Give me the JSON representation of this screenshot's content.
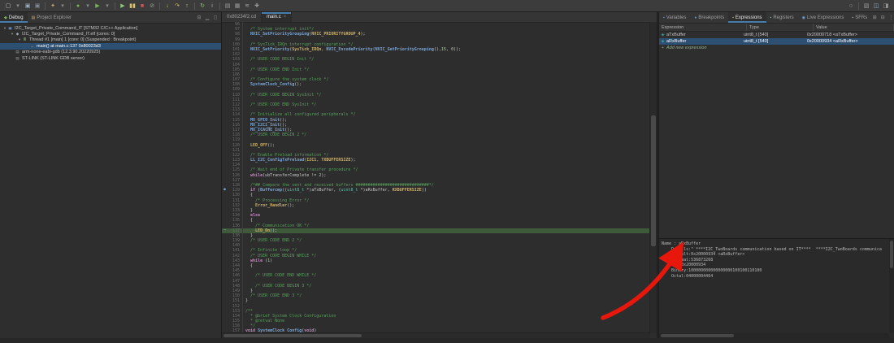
{
  "colors": {
    "annotation_red": "#e8170c",
    "selection_blue": "#2d4f72",
    "current_line_green": "#3f5a3a",
    "accent_blue": "#4a7cab"
  },
  "toolbar": {
    "left_icons": [
      {
        "name": "new-file-icon",
        "glyph": "▢",
        "color": "#b8c4ce"
      },
      {
        "name": "new-dropdown-icon",
        "glyph": "▾",
        "color": "#8d8d8d"
      },
      {
        "name": "save-icon",
        "glyph": "▣",
        "color": "#9ab0c4"
      },
      {
        "name": "save-all-icon",
        "glyph": "▣",
        "color": "#7e8f9d"
      },
      {
        "sep": true
      },
      {
        "name": "build-icon",
        "glyph": "✦",
        "color": "#c9a66b"
      },
      {
        "name": "build-dropdown-icon",
        "glyph": "▾",
        "color": "#8d8d8d"
      },
      {
        "sep": true
      },
      {
        "name": "debug-icon",
        "glyph": "●",
        "color": "#77b255"
      },
      {
        "name": "debug-dropdown-icon",
        "glyph": "▾",
        "color": "#8d8d8d"
      },
      {
        "name": "run-icon",
        "glyph": "▶",
        "color": "#77b255"
      },
      {
        "name": "run-dropdown-icon",
        "glyph": "▾",
        "color": "#8d8d8d"
      },
      {
        "sep": true
      },
      {
        "name": "resume-icon",
        "glyph": "▶",
        "color": "#8fc47a"
      },
      {
        "name": "suspend-icon",
        "glyph": "▮▮",
        "color": "#d8c26a"
      },
      {
        "name": "terminate-icon",
        "glyph": "■",
        "color": "#d9534f"
      },
      {
        "name": "disconnect-icon",
        "glyph": "⊘",
        "color": "#9a9a9a"
      },
      {
        "sep": true
      },
      {
        "name": "step-into-icon",
        "glyph": "↓",
        "color": "#d8c26a"
      },
      {
        "name": "step-over-icon",
        "glyph": "↷",
        "color": "#d8c26a"
      },
      {
        "name": "step-return-icon",
        "glyph": "↑",
        "color": "#d8c26a"
      },
      {
        "sep": true
      },
      {
        "name": "restart-icon",
        "glyph": "↻",
        "color": "#8fc47a"
      },
      {
        "name": "instruction-stepping-icon",
        "glyph": "i",
        "color": "#9ab0c4"
      },
      {
        "sep": true
      },
      {
        "name": "new-console-icon",
        "glyph": "▤",
        "color": "#9a9a9a"
      },
      {
        "name": "memory-view-icon",
        "glyph": "▦",
        "color": "#9a9a9a"
      },
      {
        "name": "trace-icon",
        "glyph": "≋",
        "color": "#9a9a9a"
      },
      {
        "name": "pin-icon",
        "glyph": "✚",
        "color": "#9a9a9a"
      }
    ],
    "right_icons": [
      {
        "name": "search-icon",
        "glyph": "○",
        "color": "#b0b0b0"
      },
      {
        "sep": true
      },
      {
        "name": "open-perspective-icon",
        "glyph": "▧",
        "color": "#9a9a9a"
      },
      {
        "name": "debug-perspective-icon",
        "glyph": "◫",
        "color": "#9ab0c4"
      },
      {
        "name": "cpp-perspective-icon",
        "glyph": "◨",
        "color": "#9a9a9a"
      }
    ]
  },
  "debug_panel": {
    "tabs": [
      {
        "label": "Debug",
        "active": true,
        "icon": "debug-view-icon",
        "glyph": "◆",
        "icon_color": "#77b255"
      },
      {
        "label": "Project Explorer",
        "active": false,
        "icon": "project-explorer-icon",
        "glyph": "▤",
        "icon_color": "#c9a66b"
      }
    ],
    "header_icons": [
      {
        "name": "collapse-all-icon",
        "glyph": "⊟"
      },
      {
        "name": "minimize-icon",
        "glyph": "▁"
      },
      {
        "name": "maximize-icon",
        "glyph": "◻"
      }
    ],
    "tree": [
      {
        "level": 0,
        "expander": "▾",
        "icon": "launch-config-icon",
        "glyph": "▣",
        "icon_color": "#6f9fd8",
        "label": "I2C_Target_Private_Command_IT [STM32 C/C++ Application]"
      },
      {
        "level": 1,
        "expander": "▾",
        "icon": "elf-binary-icon",
        "glyph": "◆",
        "icon_color": "#9ab0c4",
        "label": "I2C_Target_Private_Command_IT.elf [cores: 0]"
      },
      {
        "level": 2,
        "expander": "▾",
        "icon": "thread-icon",
        "glyph": "≣",
        "icon_color": "#8fc47a",
        "label": "Thread #1 [main] 1 [core: 0] (Suspended : Breakpoint)"
      },
      {
        "level": 3,
        "expander": "",
        "icon": "stack-frame-icon",
        "glyph": "→",
        "icon_color": "#d8c26a",
        "label": "main() at main.c:137 0x80023d3",
        "selected": true
      },
      {
        "level": 1,
        "expander": "",
        "icon": "debugger-process-icon",
        "glyph": "▤",
        "icon_color": "#9a9a9a",
        "label": "arm-none-eabi-gdb (12.3.90.20220925)"
      },
      {
        "level": 1,
        "expander": "",
        "icon": "debugger-process-icon",
        "glyph": "▤",
        "icon_color": "#9a9a9a",
        "label": "ST-LINK (ST-LINK GDB server)"
      }
    ]
  },
  "editor": {
    "tabs": [
      {
        "label": "0x80234f2.cd",
        "active": false
      },
      {
        "label": "main.c",
        "active": true
      }
    ],
    "current_line": 137,
    "breakpoint_line": 129,
    "lines": [
      {
        "n": 96,
        "seg": []
      },
      {
        "n": 97,
        "seg": [
          [
            "cm",
            "  /* System interrupt init*/"
          ]
        ]
      },
      {
        "n": 98,
        "seg": [
          [
            "pl",
            "  "
          ],
          [
            "fn",
            "NVIC_SetPriorityGrouping"
          ],
          [
            "pl",
            "("
          ],
          [
            "mc",
            "NVIC_PRIORITYGROUP_4"
          ],
          [
            "pl",
            ");"
          ]
        ]
      },
      {
        "n": 99,
        "seg": []
      },
      {
        "n": 100,
        "seg": [
          [
            "cm",
            "  /* SysTick_IRQn interrupt configuration */"
          ]
        ]
      },
      {
        "n": 101,
        "seg": [
          [
            "pl",
            "  "
          ],
          [
            "fn",
            "NVIC_SetPriority"
          ],
          [
            "pl",
            "("
          ],
          [
            "mc",
            "SysTick_IRQn"
          ],
          [
            "pl",
            ", "
          ],
          [
            "fn",
            "NVIC_EncodePriority"
          ],
          [
            "pl",
            "("
          ],
          [
            "fn",
            "NVIC_GetPriorityGrouping"
          ],
          [
            "pl",
            "(),"
          ],
          [
            "nm",
            "15"
          ],
          [
            "pl",
            ", "
          ],
          [
            "nm",
            "0"
          ],
          [
            "pl",
            "));"
          ]
        ]
      },
      {
        "n": 102,
        "seg": []
      },
      {
        "n": 103,
        "seg": [
          [
            "cm",
            "  /* USER CODE BEGIN Init */"
          ]
        ]
      },
      {
        "n": 104,
        "seg": []
      },
      {
        "n": 105,
        "seg": [
          [
            "cm",
            "  /* USER CODE END Init */"
          ]
        ]
      },
      {
        "n": 106,
        "seg": []
      },
      {
        "n": 107,
        "seg": [
          [
            "cm",
            "  /* Configure the system clock */"
          ]
        ]
      },
      {
        "n": 108,
        "seg": [
          [
            "pl",
            "  "
          ],
          [
            "fn",
            "SystemClock_Config"
          ],
          [
            "pl",
            "();"
          ]
        ]
      },
      {
        "n": 109,
        "seg": []
      },
      {
        "n": 110,
        "seg": [
          [
            "cm",
            "  /* USER CODE BEGIN SysInit */"
          ]
        ]
      },
      {
        "n": 111,
        "seg": []
      },
      {
        "n": 112,
        "seg": [
          [
            "cm",
            "  /* USER CODE END SysInit */"
          ]
        ]
      },
      {
        "n": 113,
        "seg": []
      },
      {
        "n": 114,
        "seg": [
          [
            "cm",
            "  /* Initialize all configured peripherals */"
          ]
        ]
      },
      {
        "n": 115,
        "seg": [
          [
            "pl",
            "  "
          ],
          [
            "fn",
            "MX_GPIO_Init"
          ],
          [
            "pl",
            "();"
          ]
        ]
      },
      {
        "n": 116,
        "seg": [
          [
            "pl",
            "  "
          ],
          [
            "fn",
            "MX_I2C1_Init"
          ],
          [
            "pl",
            "();"
          ]
        ]
      },
      {
        "n": 117,
        "seg": [
          [
            "pl",
            "  "
          ],
          [
            "fn",
            "MX_ICACHE_Init"
          ],
          [
            "pl",
            "();"
          ]
        ]
      },
      {
        "n": 118,
        "seg": [
          [
            "cm",
            "  /* USER CODE BEGIN 2 */"
          ]
        ]
      },
      {
        "n": 119,
        "seg": []
      },
      {
        "n": 120,
        "seg": [
          [
            "pl",
            "  "
          ],
          [
            "mc",
            "LED_OFF"
          ],
          [
            "pl",
            "();"
          ]
        ]
      },
      {
        "n": 121,
        "seg": []
      },
      {
        "n": 122,
        "seg": [
          [
            "cm",
            "  /* Enable Preload information */"
          ]
        ]
      },
      {
        "n": 123,
        "seg": [
          [
            "pl",
            "  "
          ],
          [
            "fn",
            "LL_I2C_ConfigTxPreload"
          ],
          [
            "pl",
            "("
          ],
          [
            "mc",
            "I2C1"
          ],
          [
            "pl",
            ", "
          ],
          [
            "mc",
            "TXBUFFERSIZE"
          ],
          [
            "pl",
            ");"
          ]
        ]
      },
      {
        "n": 124,
        "seg": []
      },
      {
        "n": 125,
        "seg": [
          [
            "cm",
            "  /* Wait end of Private transfer procedure */"
          ]
        ]
      },
      {
        "n": 126,
        "seg": [
          [
            "pl",
            "  "
          ],
          [
            "kw",
            "while"
          ],
          [
            "pl",
            "(ubTransferComplete != "
          ],
          [
            "nm",
            "2"
          ],
          [
            "pl",
            ");"
          ]
        ]
      },
      {
        "n": 127,
        "seg": []
      },
      {
        "n": 128,
        "seg": [
          [
            "cm",
            "  /*## Compare the sent and received buffers ##############################*/"
          ]
        ]
      },
      {
        "n": 129,
        "seg": [
          [
            "pl",
            "  "
          ],
          [
            "kw",
            "if"
          ],
          [
            "pl",
            " ("
          ],
          [
            "fn",
            "Buffercmp"
          ],
          [
            "pl",
            "(("
          ],
          [
            "ty",
            "uint8_t"
          ],
          [
            "pl",
            " *)aTxBuffer, ("
          ],
          [
            "ty",
            "uint8_t"
          ],
          [
            "pl",
            " *)aRxBuffer, "
          ],
          [
            "mc",
            "RXBUFFERSIZE"
          ],
          [
            "pl",
            "))"
          ]
        ]
      },
      {
        "n": 130,
        "seg": [
          [
            "pl",
            "  {"
          ]
        ]
      },
      {
        "n": 131,
        "seg": [
          [
            "cm",
            "    /* Processing Error */"
          ]
        ]
      },
      {
        "n": 132,
        "seg": [
          [
            "pl",
            "    "
          ],
          [
            "mc",
            "Error_Handler"
          ],
          [
            "pl",
            "();"
          ]
        ]
      },
      {
        "n": 133,
        "seg": [
          [
            "pl",
            "  }"
          ]
        ]
      },
      {
        "n": 134,
        "seg": [
          [
            "pl",
            "  "
          ],
          [
            "kw",
            "else"
          ]
        ]
      },
      {
        "n": 135,
        "seg": [
          [
            "pl",
            "  {"
          ]
        ]
      },
      {
        "n": 136,
        "seg": [
          [
            "cm",
            "    /* Communication OK */"
          ]
        ]
      },
      {
        "n": 137,
        "seg": [
          [
            "pl",
            "    "
          ],
          [
            "mc",
            "LED_On"
          ],
          [
            "pl",
            "();"
          ]
        ]
      },
      {
        "n": 138,
        "seg": [
          [
            "pl",
            "  }"
          ]
        ]
      },
      {
        "n": 139,
        "seg": [
          [
            "cm",
            "  /* USER CODE END 2 */"
          ]
        ]
      },
      {
        "n": 140,
        "seg": []
      },
      {
        "n": 141,
        "seg": [
          [
            "cm",
            "  /* Infinite loop */"
          ]
        ]
      },
      {
        "n": 142,
        "seg": [
          [
            "cm",
            "  /* USER CODE BEGIN WHILE */"
          ]
        ]
      },
      {
        "n": 143,
        "seg": [
          [
            "pl",
            "  "
          ],
          [
            "kw",
            "while"
          ],
          [
            "pl",
            " ("
          ],
          [
            "nm",
            "1"
          ],
          [
            "pl",
            ")"
          ]
        ]
      },
      {
        "n": 144,
        "seg": [
          [
            "pl",
            "  {"
          ]
        ]
      },
      {
        "n": 145,
        "seg": []
      },
      {
        "n": 146,
        "seg": [
          [
            "cm",
            "    /* USER CODE END WHILE */"
          ]
        ]
      },
      {
        "n": 147,
        "seg": []
      },
      {
        "n": 148,
        "seg": [
          [
            "cm",
            "    /* USER CODE BEGIN 3 */"
          ]
        ]
      },
      {
        "n": 149,
        "seg": [
          [
            "pl",
            "  }"
          ]
        ]
      },
      {
        "n": 150,
        "seg": [
          [
            "cm",
            "  /* USER CODE END 3 */"
          ]
        ]
      },
      {
        "n": 151,
        "seg": [
          [
            "pl",
            "}"
          ]
        ]
      },
      {
        "n": 152,
        "seg": []
      },
      {
        "n": 153,
        "seg": [
          [
            "cm",
            "/**"
          ]
        ]
      },
      {
        "n": 154,
        "seg": [
          [
            "cm",
            "  * @brief System Clock Configuration"
          ]
        ]
      },
      {
        "n": 155,
        "seg": [
          [
            "cm",
            "  * @retval None"
          ]
        ]
      },
      {
        "n": 156,
        "seg": [
          [
            "cm",
            "  */"
          ]
        ]
      },
      {
        "n": 157,
        "seg": [
          [
            "kw",
            "void"
          ],
          [
            "pl",
            " "
          ],
          [
            "fn",
            "SystemClock_Config"
          ],
          [
            "pl",
            "("
          ],
          [
            "kw",
            "void"
          ],
          [
            "pl",
            ")"
          ]
        ]
      }
    ]
  },
  "expressions_panel": {
    "tabs": [
      {
        "label": "Variables",
        "icon": "variables-view-icon",
        "glyph": "▪",
        "icon_color": "#6f9fd8"
      },
      {
        "label": "Breakpoints",
        "icon": "breakpoints-view-icon",
        "glyph": "●",
        "icon_color": "#5d8fbe"
      },
      {
        "label": "Expressions",
        "active": true,
        "icon": "expressions-view-icon",
        "glyph": "▪",
        "icon_color": "#c9a66b"
      },
      {
        "label": "Registers",
        "icon": "registers-view-icon",
        "glyph": "▪",
        "icon_color": "#8fbc8f"
      },
      {
        "label": "Live Expressions",
        "icon": "live-expressions-view-icon",
        "glyph": "◉",
        "icon_color": "#6f9fd8"
      },
      {
        "label": "SFRs",
        "icon": "sfrs-view-icon",
        "glyph": "▪",
        "icon_color": "#aaaaaa"
      }
    ],
    "header_icons": [
      {
        "name": "add-expression-toolbar-icon",
        "glyph": "⊞"
      },
      {
        "name": "collapse-all-icon",
        "glyph": "⊟"
      },
      {
        "name": "view-menu-icon",
        "glyph": "⋮"
      },
      {
        "name": "maximize-icon",
        "glyph": "◻"
      }
    ],
    "columns": [
      "Expression",
      "Type",
      "Value"
    ],
    "rows": [
      {
        "expression": "aTxBuffer",
        "type": "uint8_t [540]",
        "value": "0x20000718 <aTxBuffer>",
        "selected": false
      },
      {
        "expression": "aRxBuffer",
        "type": "uint8_t [540]",
        "value": "0x20000934 <aRxBuffer>",
        "selected": true
      },
      {
        "expression": "Add new expression",
        "type": "",
        "value": "",
        "add": true
      }
    ],
    "detail_lines": [
      "Name : aRxBuffer",
      "    Details:\" ****I2C_TwoBoards communication based on IT****  ****I2C_TwoBoards communica",
      "    Default:0x20000934 <aRxBuffer>",
      "    Decimal:536873268",
      "    Hex:0x20000934",
      "    Binary:100000000000000000100100110100",
      "    Octal:04000004464"
    ]
  }
}
